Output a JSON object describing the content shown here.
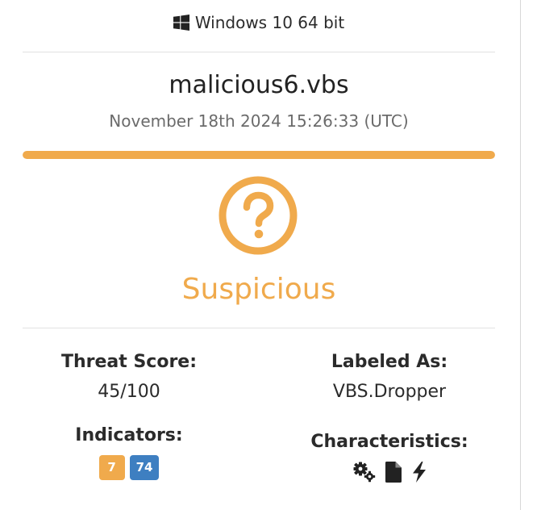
{
  "environment": {
    "os_icon": "windows-icon",
    "os_label": "Windows 10 64 bit"
  },
  "report": {
    "filename": "malicious6.vbs",
    "timestamp": "November 18th 2024 15:26:33 (UTC)"
  },
  "verdict": {
    "icon": "question-circle-icon",
    "label": "Suspicious",
    "color": "#f0aa4c",
    "score_fraction": 1.0
  },
  "threat_score": {
    "heading": "Threat Score:",
    "value": "45/100"
  },
  "labeled_as": {
    "heading": "Labeled As:",
    "value": "VBS.Dropper"
  },
  "indicators": {
    "heading": "Indicators:",
    "badges": [
      {
        "value": "7",
        "color": "#f0aa4c"
      },
      {
        "value": "74",
        "color": "#3e7fc1"
      }
    ]
  },
  "characteristics": {
    "heading": "Characteristics:",
    "icons": [
      "cogs-icon",
      "file-icon",
      "bolt-icon"
    ]
  }
}
